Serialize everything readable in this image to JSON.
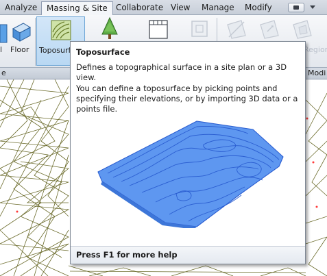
{
  "tabs": [
    {
      "label": "Analyze",
      "active": false
    },
    {
      "label": "Massing & Site",
      "active": true
    },
    {
      "label": "Collaborate",
      "active": false
    },
    {
      "label": "View",
      "active": false
    },
    {
      "label": "Manage",
      "active": false
    },
    {
      "label": "Modify",
      "active": false
    }
  ],
  "ribbon": {
    "floor_label": "Floor",
    "floor_prefix": "l",
    "toposurface_label": "Toposurface",
    "region_label": "Region",
    "panel_left_label": "e",
    "panel_right_label": "Modi"
  },
  "tooltip": {
    "title": "Toposurface",
    "description": "Defines a topographical surface in a site plan or a 3D view.",
    "details": "You can define a toposurface by picking points and specifying their elevations, or by importing 3D data or a points file.",
    "footer": "Press F1 for more help"
  },
  "colors": {
    "accent_selected": "#b9d8f3",
    "topo_fill": "#5e97f0",
    "topo_lines": "#2b5ed1",
    "site_lines": "#6b6b2b"
  }
}
